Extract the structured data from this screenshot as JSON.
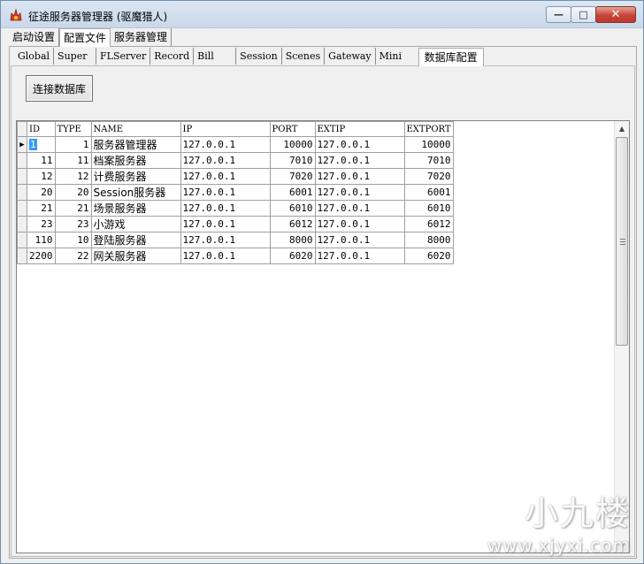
{
  "window": {
    "title": "征途服务器管理器  (驱魔猎人)",
    "minimize_glyph": "—",
    "maximize_glyph": "□",
    "close_glyph": "✕"
  },
  "main_tabs": [
    {
      "label": "启动设置"
    },
    {
      "label": "配置文件"
    },
    {
      "label": "服务器管理"
    }
  ],
  "config_tabs": [
    {
      "label": "Global"
    },
    {
      "label": "Super"
    },
    {
      "label": "FLServer"
    },
    {
      "label": "Record"
    },
    {
      "label": "Bill"
    },
    {
      "label": "Session"
    },
    {
      "label": "Scenes"
    },
    {
      "label": "Gateway"
    },
    {
      "label": "Mini"
    },
    {
      "label": "数据库配置"
    }
  ],
  "connect_button_label": "连接数据库",
  "grid": {
    "columns": [
      "ID",
      "TYPE",
      "NAME",
      "IP",
      "PORT",
      "EXTIP",
      "EXTPORT"
    ],
    "current_row_marker": "▶",
    "rows": [
      {
        "id": "1",
        "type": "1",
        "name": "服务器管理器",
        "ip": "127.0.0.1",
        "port": "10000",
        "extip": "127.0.0.1",
        "extport": "10000"
      },
      {
        "id": "11",
        "type": "11",
        "name": "档案服务器",
        "ip": "127.0.0.1",
        "port": "7010",
        "extip": "127.0.0.1",
        "extport": "7010"
      },
      {
        "id": "12",
        "type": "12",
        "name": "计费服务器",
        "ip": "127.0.0.1",
        "port": "7020",
        "extip": "127.0.0.1",
        "extport": "7020"
      },
      {
        "id": "20",
        "type": "20",
        "name": "Session服务器",
        "ip": "127.0.0.1",
        "port": "6001",
        "extip": "127.0.0.1",
        "extport": "6001"
      },
      {
        "id": "21",
        "type": "21",
        "name": "场景服务器",
        "ip": "127.0.0.1",
        "port": "6010",
        "extip": "127.0.0.1",
        "extport": "6010"
      },
      {
        "id": "23",
        "type": "23",
        "name": "小游戏",
        "ip": "127.0.0.1",
        "port": "6012",
        "extip": "127.0.0.1",
        "extport": "6012"
      },
      {
        "id": "110",
        "type": "10",
        "name": "登陆服务器",
        "ip": "127.0.0.1",
        "port": "8000",
        "extip": "127.0.0.1",
        "extport": "8000"
      },
      {
        "id": "2200",
        "type": "22",
        "name": "网关服务器",
        "ip": "127.0.0.1",
        "port": "6020",
        "extip": "127.0.0.1",
        "extport": "6020"
      }
    ]
  },
  "watermark": {
    "line1": "小九楼",
    "line2": "www.xjyxi.com"
  }
}
